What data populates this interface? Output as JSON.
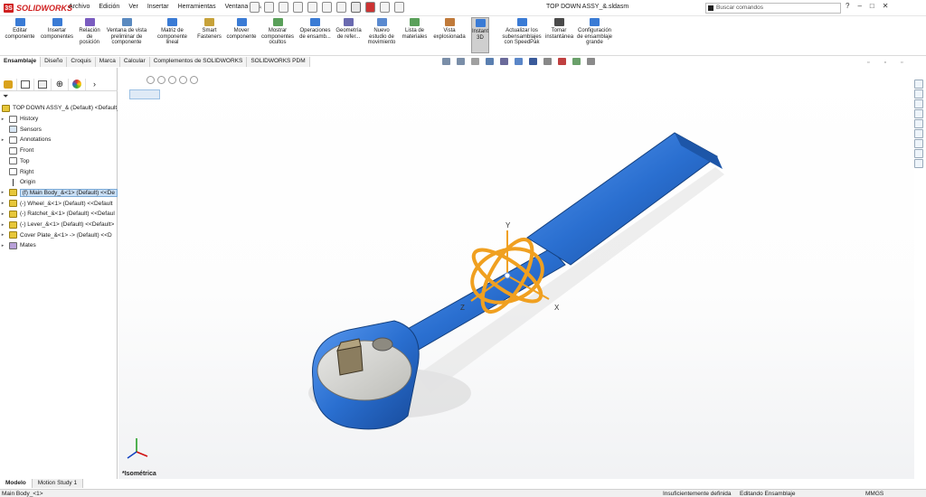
{
  "app": {
    "logo": "SOLIDWORKS"
  },
  "menu": [
    "Archivo",
    "Edición",
    "Ver",
    "Insertar",
    "Herramientas",
    "Ventana"
  ],
  "document_title": "TOP DOWN ASSY_&.sldasm",
  "search": {
    "placeholder": "Buscar comandos"
  },
  "window_buttons": [
    "?",
    "–",
    "□",
    "✕"
  ],
  "ribbon": [
    {
      "label": "Editar componente",
      "icon": "edit-component-icon"
    },
    {
      "label": "Insertar componentes",
      "icon": "insert-components-icon"
    },
    {
      "label": "Relación de posición",
      "icon": "mate-icon"
    },
    {
      "label": "Ventana de vista preliminar de componente",
      "icon": "component-preview-icon"
    },
    {
      "label": "Matriz de componente lineal",
      "icon": "linear-pattern-icon"
    },
    {
      "label": "Smart Fasteners",
      "icon": "smart-fasteners-icon"
    },
    {
      "label": "Mover componente",
      "icon": "move-component-icon"
    },
    {
      "label": "Mostrar componentes ocultos",
      "icon": "show-hidden-icon"
    },
    {
      "label": "Operaciones de ensamb...",
      "icon": "assembly-features-icon"
    },
    {
      "label": "Geometría de refer...",
      "icon": "reference-geometry-icon"
    },
    {
      "label": "Nuevo estudio de movimiento",
      "icon": "motion-study-icon"
    },
    {
      "label": "Lista de materiales",
      "icon": "bom-icon"
    },
    {
      "label": "Vista explosionada",
      "icon": "exploded-view-icon"
    },
    {
      "label": "Instant 3D",
      "icon": "instant3d-icon"
    },
    {
      "label": "Actualizar los subensamblajes con SpeedPak",
      "icon": "speedpak-icon"
    },
    {
      "label": "Tomar instantánea",
      "icon": "snapshot-icon"
    },
    {
      "label": "Configuración de ensamblaje grande",
      "icon": "large-assembly-icon"
    }
  ],
  "command_tabs": [
    "Ensamblaje",
    "Diseño",
    "Croquis",
    "Marca",
    "Calcular",
    "Complementos de SOLIDWORKS",
    "SOLIDWORKS PDM"
  ],
  "active_command_tab": "Ensamblaje",
  "tree": {
    "root": "TOP DOWN ASSY_& (Default) <Default_D",
    "items": [
      {
        "label": "History",
        "icon": "history-icon",
        "expand": true
      },
      {
        "label": "Sensors",
        "icon": "sensors-icon",
        "expand": false
      },
      {
        "label": "Annotations",
        "icon": "annotations-icon",
        "expand": true
      },
      {
        "label": "Front",
        "icon": "plane-icon",
        "expand": false
      },
      {
        "label": "Top",
        "icon": "plane-icon",
        "expand": false
      },
      {
        "label": "Right",
        "icon": "plane-icon",
        "expand": false
      },
      {
        "label": "Origin",
        "icon": "origin-icon",
        "expand": false
      },
      {
        "label": "(f) Main Body_&<1> (Default) <<De",
        "icon": "part-icon",
        "expand": true,
        "selected": true
      },
      {
        "label": "(-) Wheel_&<1> (Default) <<Default",
        "icon": "part-icon",
        "expand": true
      },
      {
        "label": "(-) Ratchet_&<1> (Default) <<Defaul",
        "icon": "part-icon",
        "expand": true
      },
      {
        "label": "(-) Lever_&<1> (Default) <<Default>",
        "icon": "part-icon",
        "expand": true
      },
      {
        "label": "Cover Plate_&<1> -> (Default) <<D",
        "icon": "part-icon",
        "expand": true
      },
      {
        "label": "Mates",
        "icon": "mates-icon",
        "expand": true
      }
    ]
  },
  "bottom_tabs": [
    "Modelo",
    "Motion Study 1"
  ],
  "view_label": "*Isométrica",
  "triad": {
    "x": "X",
    "y": "Y",
    "z": "Z"
  },
  "status": {
    "selection": "Main Body_<1>",
    "definition": "Insuficientemente definida",
    "mode": "Editando Ensamblaje",
    "units": "MMGS"
  },
  "colors": {
    "accent_blue": "#2a6fd0",
    "triad_orange": "#f0a020",
    "part_yellow": "#e7c73a"
  }
}
